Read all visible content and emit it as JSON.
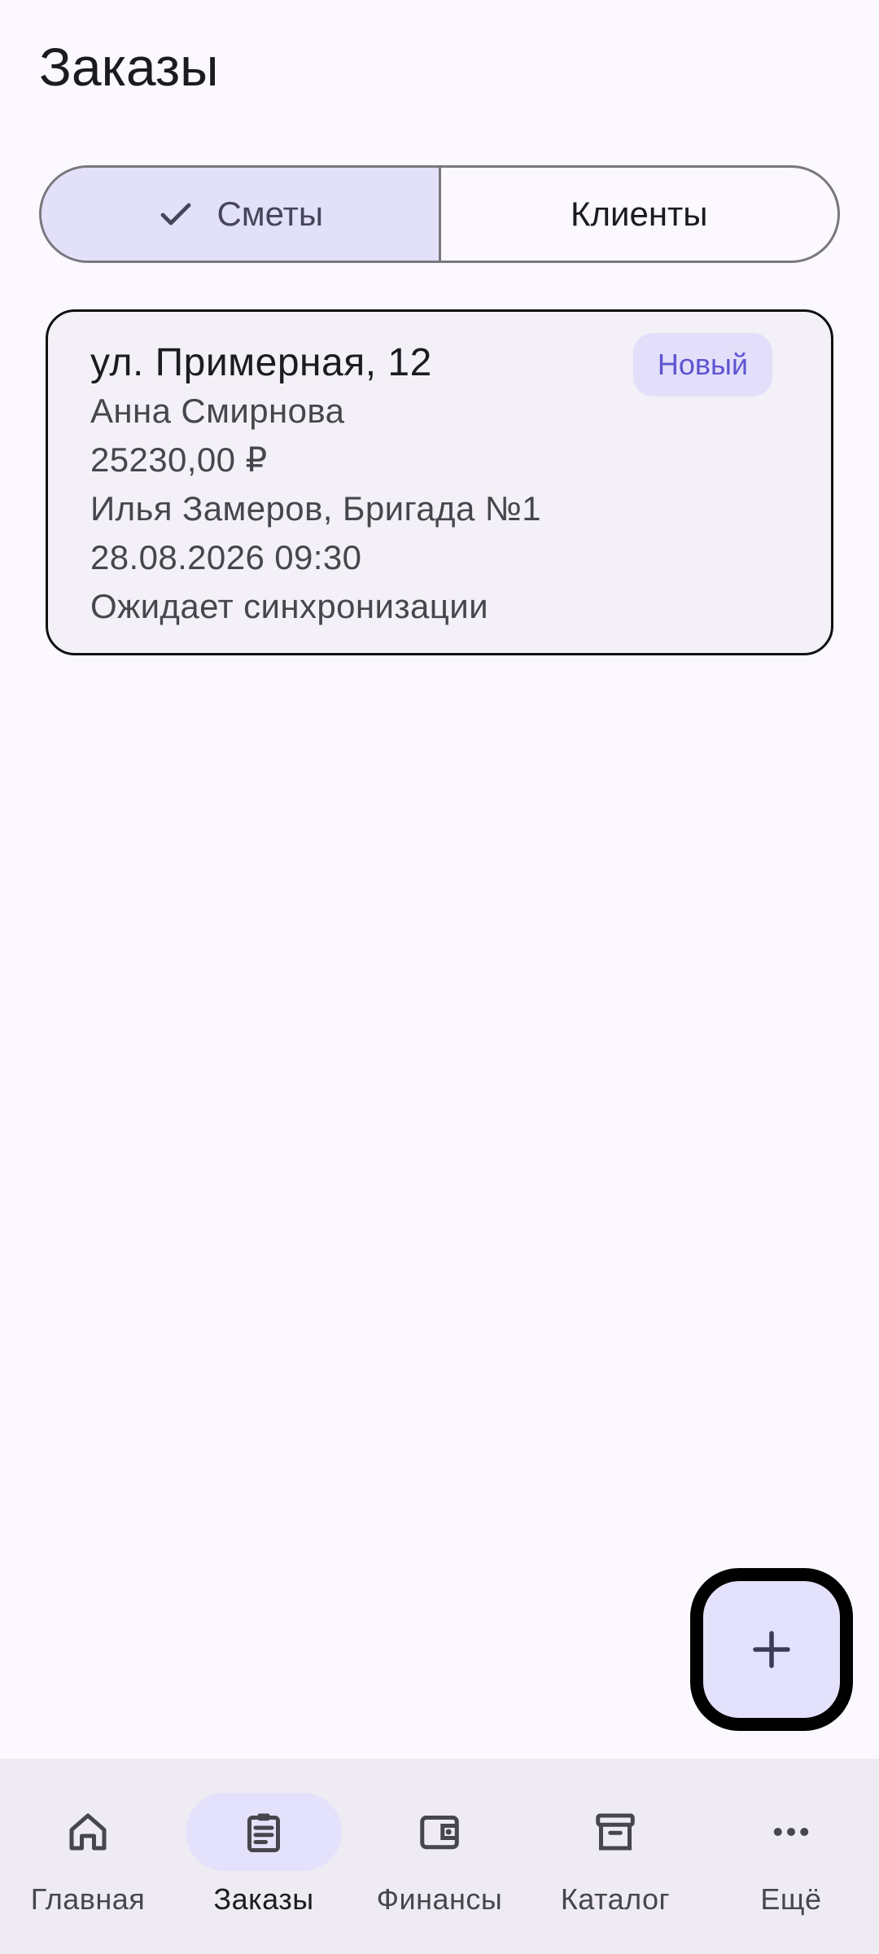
{
  "header": {
    "title": "Заказы"
  },
  "segmented": {
    "options": [
      {
        "label": "Сметы",
        "selected": true
      },
      {
        "label": "Клиенты",
        "selected": false
      }
    ]
  },
  "orders": [
    {
      "address": "ул. Примерная, 12",
      "status": "Новый",
      "client": "Анна Смирнова",
      "amount": "25230,00 ₽",
      "crew": "Илья Замеров, Бригада №1",
      "datetime": "28.08.2026 09:30",
      "sync_status": "Ожидает синхронизации"
    }
  ],
  "fab": {
    "icon": "plus-icon"
  },
  "bottom_nav": {
    "items": [
      {
        "label": "Главная",
        "icon": "home-icon",
        "active": false
      },
      {
        "label": "Заказы",
        "icon": "clipboard-icon",
        "active": true
      },
      {
        "label": "Финансы",
        "icon": "wallet-icon",
        "active": false
      },
      {
        "label": "Каталог",
        "icon": "archive-icon",
        "active": false
      },
      {
        "label": "Ещё",
        "icon": "more-horizontal-icon",
        "active": false
      }
    ]
  },
  "colors": {
    "background": "#fbf8ff",
    "accent_container": "#e3e1fb",
    "badge_text": "#5d55d0",
    "nav_background": "#efebf3"
  }
}
